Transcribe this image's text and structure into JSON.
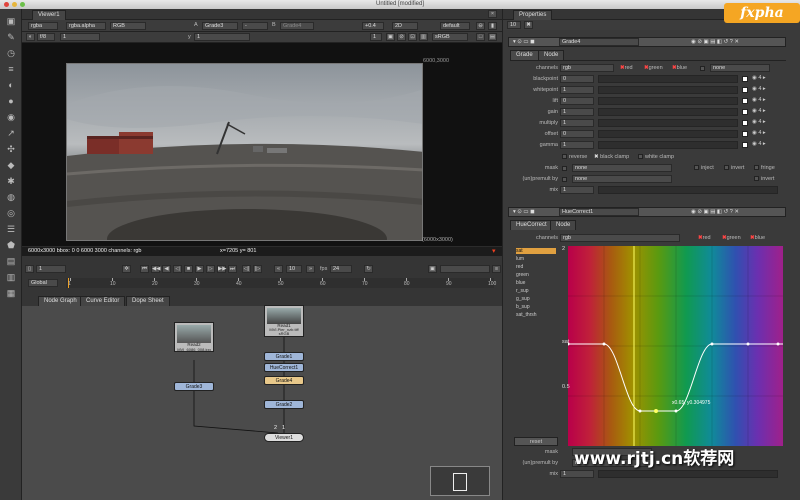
{
  "window": {
    "title": "Untitled [modified]"
  },
  "viewer": {
    "tab": "Viewer1",
    "row1": {
      "channels": "rgba",
      "alpha": "rgba.alpha",
      "colorspace": "RGB",
      "a_label": "A",
      "a_input": "Grade3",
      "a_op": "-",
      "b_label": "B",
      "b_input": "Grade4",
      "gain": "+0.4",
      "mode": "2D",
      "proxy": "default"
    },
    "row2": {
      "fstop": "f/8",
      "frame": "1",
      "y_label": "y",
      "y_value": "1",
      "zoom": "1",
      "lut": "sRGB"
    },
    "format_label_top": "6000,3000",
    "format_label_bottom": "(6000x3000)",
    "status": {
      "info": "6000x3000  bbox: 0 0 6000 3000  channels: rgb",
      "coords": "x=7205 y= 801"
    }
  },
  "timeline": {
    "frame": "1",
    "increment": "10",
    "fps_label": "fps",
    "fps": "24",
    "range_mode": "Global",
    "ticks": [
      "1",
      "10",
      "20",
      "30",
      "40",
      "50",
      "60",
      "70",
      "80",
      "90",
      "100"
    ]
  },
  "graph": {
    "tabs": [
      "Node Graph",
      "Curve Editor",
      "Dope Sheet"
    ],
    "nodes": {
      "read2": "Read2",
      "read2_file": "MVI_6086_008.jpg",
      "grade3": "Grade3",
      "read1": "Read1",
      "read1_file": "MVI.Pier_nzb.tiff",
      "read1_cs": "sRGB",
      "grade1": "Grade1",
      "huecorrect1": "HueCorrect1",
      "grade4": "Grade4",
      "grade2": "Grade2",
      "viewer1": "Viewer1"
    },
    "viewer_inputs": [
      "2",
      "1"
    ]
  },
  "properties": {
    "title": "Properties",
    "count": "10",
    "grade": {
      "name": "Grade4",
      "tabs": [
        "Grade",
        "Node"
      ],
      "channels_label": "channels",
      "channels": "rgb",
      "channel_flags": [
        "red",
        "green",
        "blue"
      ],
      "channel_extra": "none",
      "rows": [
        {
          "label": "blackpoint",
          "value": "0"
        },
        {
          "label": "whitepoint",
          "value": "1"
        },
        {
          "label": "lift",
          "value": "0"
        },
        {
          "label": "gain",
          "value": "1"
        },
        {
          "label": "multiply",
          "value": "1"
        },
        {
          "label": "offset",
          "value": "0"
        },
        {
          "label": "gamma",
          "value": "1"
        }
      ],
      "options": [
        "reverse",
        "black clamp",
        "white clamp"
      ],
      "mask_label": "mask",
      "mask_value": "none",
      "mask_flags": [
        "inject",
        "invert",
        "fringe"
      ],
      "premult_label": "(un)premult by",
      "premult_value": "none",
      "premult_flag": "invert",
      "mix_label": "mix",
      "mix_value": "1"
    },
    "huecorrect": {
      "name": "HueCorrect1",
      "tabs": [
        "HueCorrect",
        "Node"
      ],
      "channels_label": "channels",
      "channels": "rgb",
      "channel_flags": [
        "red",
        "green",
        "blue"
      ],
      "curves": [
        "sat",
        "lum",
        "red",
        "green",
        "blue",
        "r_sup",
        "g_sup",
        "b_sup",
        "sat_thrsh"
      ],
      "y_labels": [
        "2",
        "sat",
        "0.5"
      ],
      "point_label": "x0.65, y0.304975",
      "reset": "reset",
      "mask_label": "mask",
      "premult_label": "(un)premult by",
      "premult_value": "none",
      "mix_label": "mix",
      "mix_value": "1"
    }
  },
  "watermark": {
    "brand": "fxpha",
    "site": "www.rjtj.cn软荐网"
  },
  "colors": {
    "accent": "#f0a020",
    "selected_node": "#e8c88a",
    "grade_node": "#9fb6d8"
  }
}
